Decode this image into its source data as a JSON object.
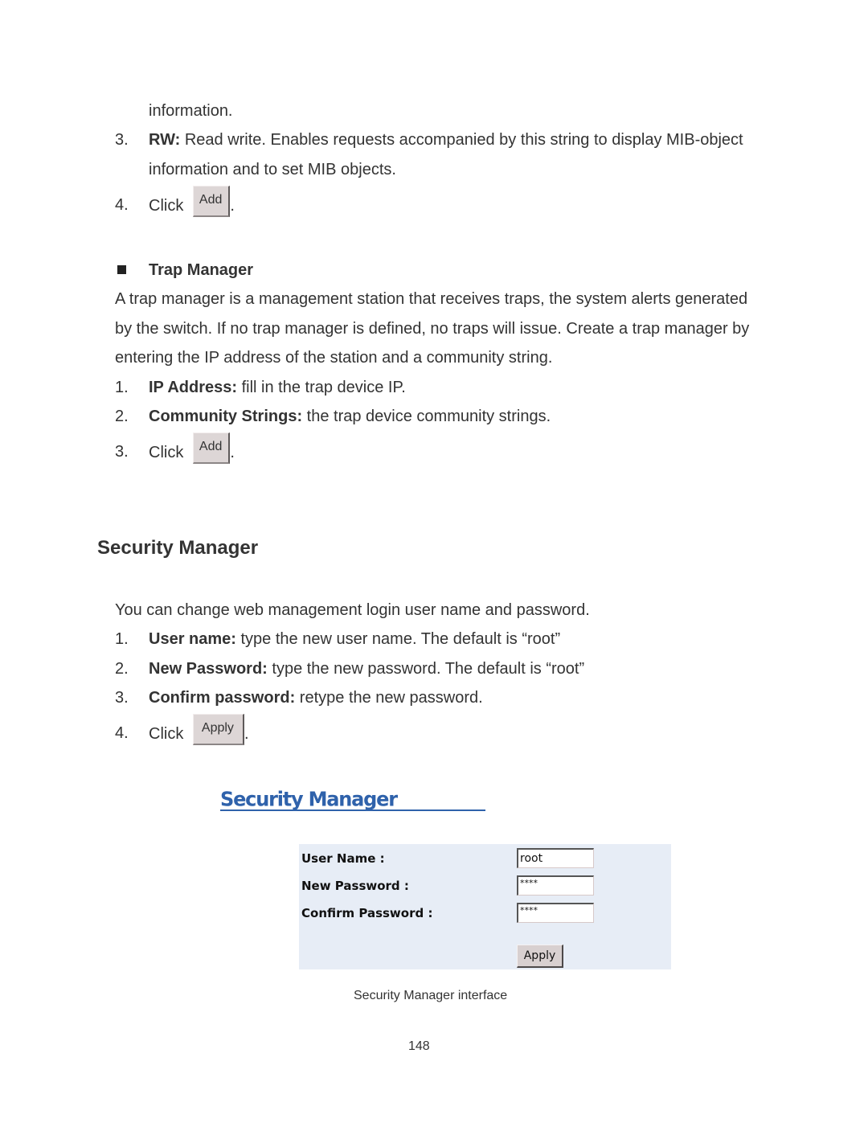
{
  "intro": {
    "continuation": "information.",
    "items": [
      {
        "number": "3.",
        "bold": "RW:",
        "text": " Read write. Enables requests accompanied by this string to display MIB-object",
        "continuation": "information and to set MIB objects."
      },
      {
        "number": "4.",
        "click_label": "Click",
        "button": "Add",
        "after": "."
      }
    ]
  },
  "trap_manager": {
    "heading": "Trap Manager",
    "bullet_icon": "square-bullet",
    "paragraph_lines": [
      "A trap manager is a management station that receives traps, the system alerts generated",
      "by the switch. If no trap manager is defined, no traps will issue. Create a trap manager by",
      "entering the IP address of the station and a community string."
    ],
    "items": [
      {
        "number": "1.",
        "bold": "IP Address:",
        "text": " fill in the trap device IP."
      },
      {
        "number": "2.",
        "bold": "Community Strings:",
        "text": " the trap device community strings."
      },
      {
        "number": "3.",
        "click_label": "Click",
        "button": "Add",
        "after": "."
      }
    ]
  },
  "security_manager": {
    "heading": "Security Manager",
    "intro": "You can change web management login user name and password.",
    "items": [
      {
        "number": "1.",
        "bold": "User name:",
        "text": " type the new user name. The default is “root”"
      },
      {
        "number": "2.",
        "bold": "New Password:",
        "text": " type the new password. The default is “root”"
      },
      {
        "number": "3.",
        "bold": "Confirm password:",
        "text": " retype the new password."
      },
      {
        "number": "4.",
        "click_label": "Click",
        "button": "Apply",
        "after": "."
      }
    ]
  },
  "figure": {
    "title": "Security Manager",
    "title_color": "#2f62ab",
    "panel_color": "#e7edf6",
    "fields": [
      {
        "label": "User Name :",
        "value": "root"
      },
      {
        "label": "New Password :",
        "value": "****"
      },
      {
        "label": "Confirm Password :",
        "value": "****"
      }
    ],
    "apply_button": "Apply",
    "caption": "Security Manager interface"
  },
  "page_number": "148"
}
